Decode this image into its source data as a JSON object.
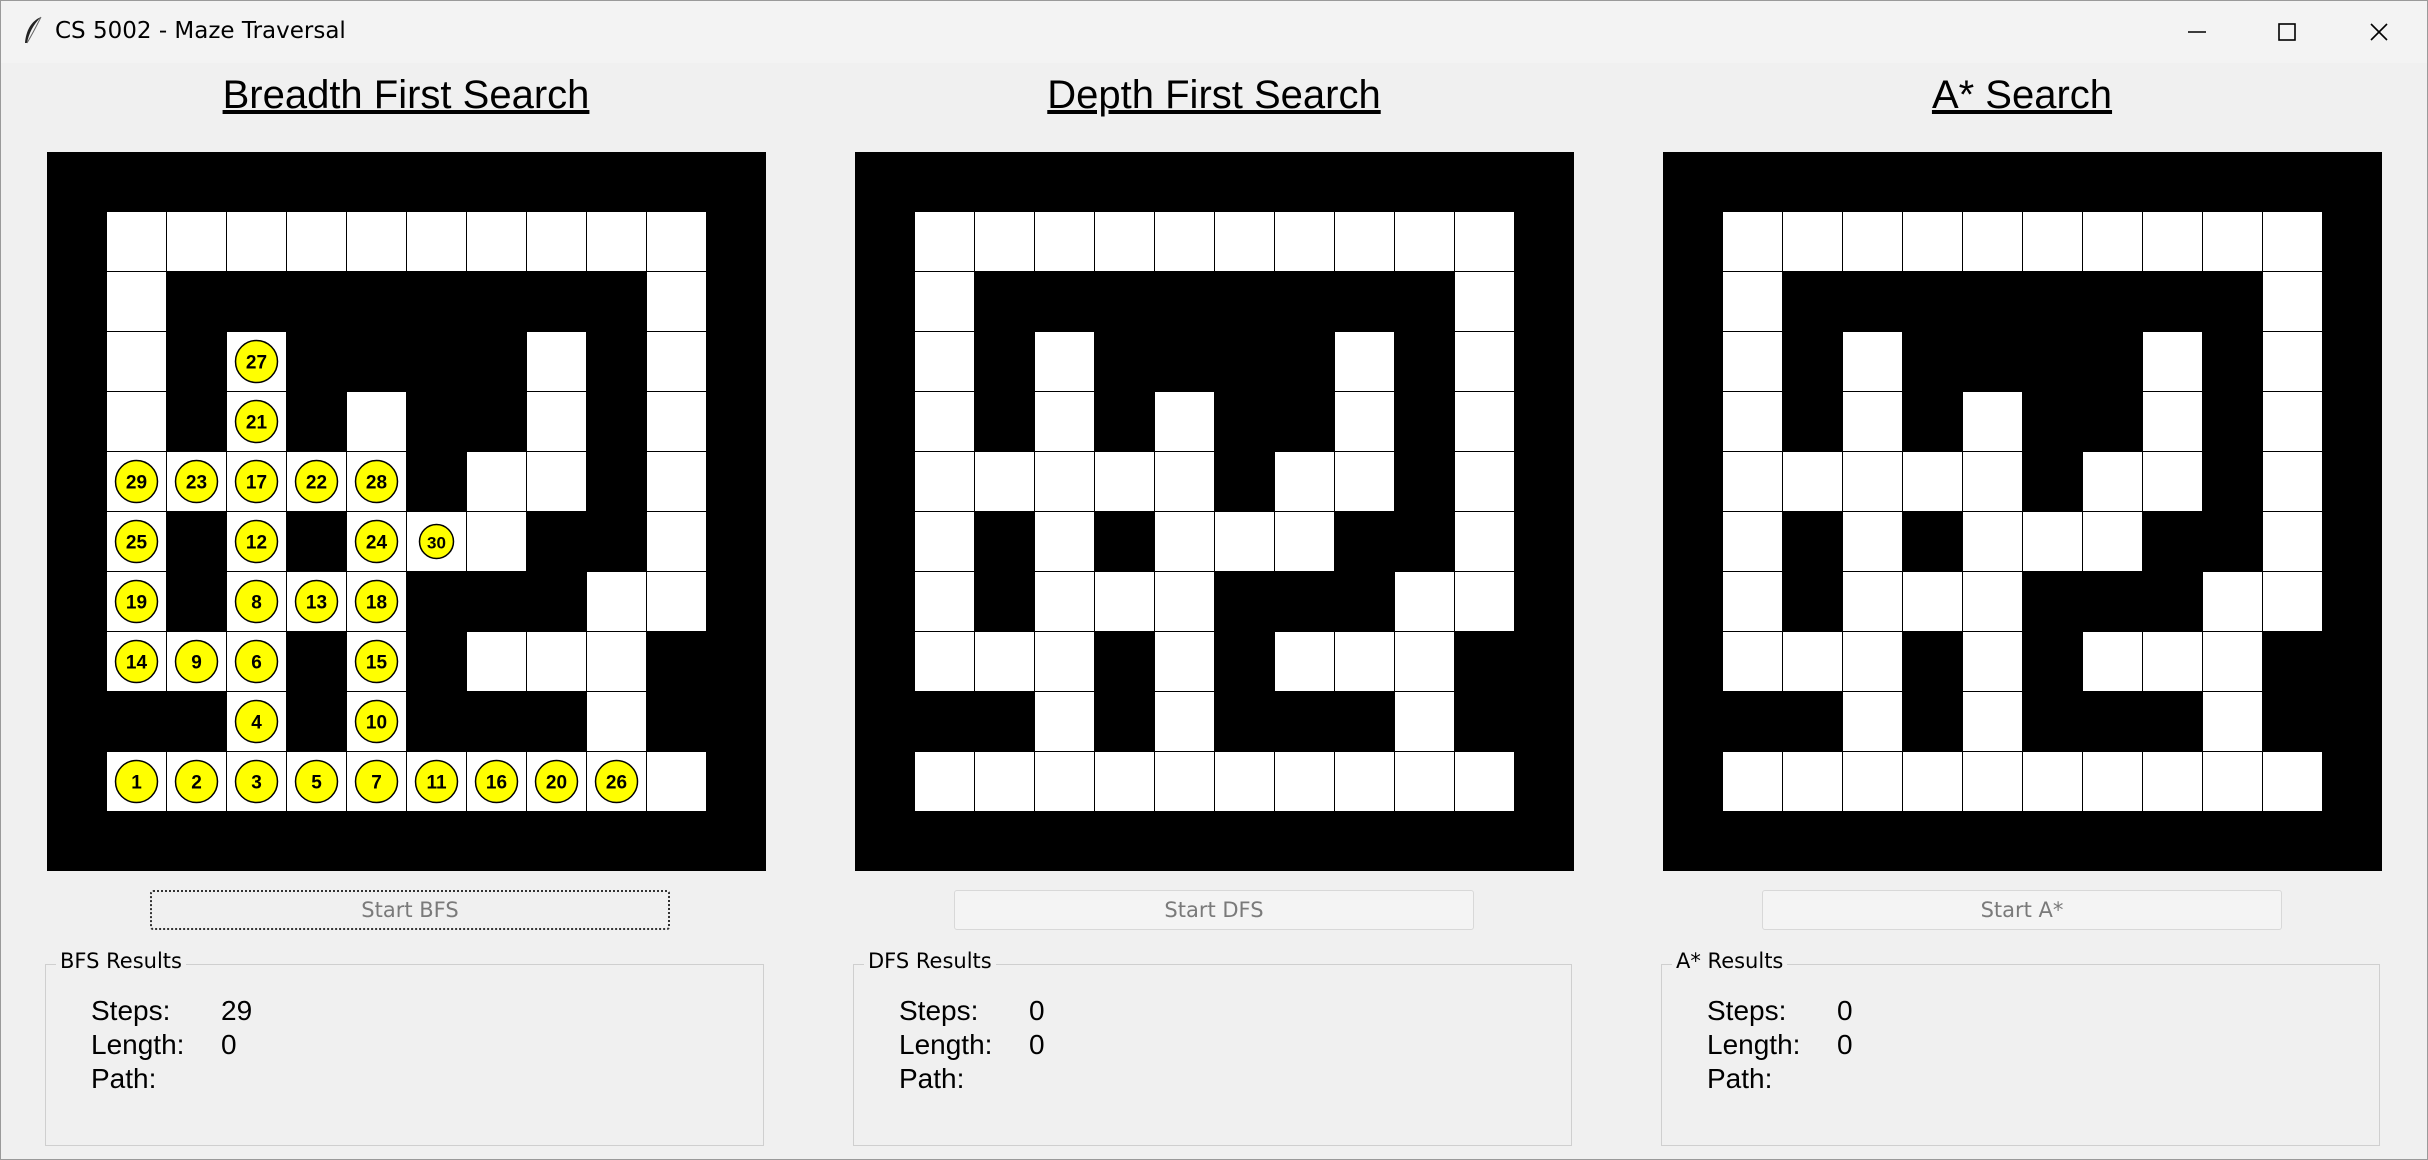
{
  "window": {
    "title": "CS 5002 - Maze Traversal"
  },
  "maze": {
    "cols": 10,
    "rows": 10,
    "walls": [
      "0000000000",
      "0111111110",
      "0101111010",
      "0101011010",
      "0000010010",
      "0101000110",
      "0100011100",
      "0001010001",
      "1101011101",
      "0000000000"
    ],
    "colors": {
      "wall": "#000000",
      "open": "#ffffff",
      "grid": "#000000",
      "visited": "#ffff00"
    }
  },
  "panels": [
    {
      "id": "bfs",
      "title": "Breadth First Search",
      "button_label": "Start BFS",
      "results_title": "BFS Results",
      "steps_label": "Steps:",
      "steps_value": "29",
      "length_label": "Length:",
      "length_value": "0",
      "path_label": "Path:",
      "path_value": "",
      "visited": [
        {
          "r": 9,
          "c": 0,
          "n": "1"
        },
        {
          "r": 9,
          "c": 1,
          "n": "2"
        },
        {
          "r": 9,
          "c": 2,
          "n": "3"
        },
        {
          "r": 8,
          "c": 2,
          "n": "4"
        },
        {
          "r": 9,
          "c": 3,
          "n": "5"
        },
        {
          "r": 7,
          "c": 2,
          "n": "6"
        },
        {
          "r": 9,
          "c": 4,
          "n": "7"
        },
        {
          "r": 6,
          "c": 2,
          "n": "8"
        },
        {
          "r": 7,
          "c": 1,
          "n": "9"
        },
        {
          "r": 8,
          "c": 4,
          "n": "10"
        },
        {
          "r": 9,
          "c": 5,
          "n": "11"
        },
        {
          "r": 5,
          "c": 2,
          "n": "12"
        },
        {
          "r": 6,
          "c": 3,
          "n": "13"
        },
        {
          "r": 7,
          "c": 0,
          "n": "14"
        },
        {
          "r": 7,
          "c": 4,
          "n": "15"
        },
        {
          "r": 9,
          "c": 6,
          "n": "16"
        },
        {
          "r": 4,
          "c": 2,
          "n": "17"
        },
        {
          "r": 6,
          "c": 4,
          "n": "18"
        },
        {
          "r": 6,
          "c": 0,
          "n": "19"
        },
        {
          "r": 9,
          "c": 7,
          "n": "20"
        },
        {
          "r": 3,
          "c": 2,
          "n": "21"
        },
        {
          "r": 4,
          "c": 3,
          "n": "22"
        },
        {
          "r": 4,
          "c": 1,
          "n": "23"
        },
        {
          "r": 5,
          "c": 4,
          "n": "24"
        },
        {
          "r": 5,
          "c": 0,
          "n": "25"
        },
        {
          "r": 9,
          "c": 8,
          "n": "26"
        },
        {
          "r": 2,
          "c": 2,
          "n": "27"
        },
        {
          "r": 4,
          "c": 4,
          "n": "28"
        },
        {
          "r": 4,
          "c": 0,
          "n": "29"
        },
        {
          "r": 5,
          "c": 5,
          "n": "30"
        }
      ]
    },
    {
      "id": "dfs",
      "title": "Depth First Search",
      "button_label": "Start DFS",
      "results_title": "DFS Results",
      "steps_label": "Steps:",
      "steps_value": "0",
      "length_label": "Length:",
      "length_value": "0",
      "path_label": "Path:",
      "path_value": "",
      "visited": []
    },
    {
      "id": "astar",
      "title": "A* Search",
      "button_label": "Start A*",
      "results_title": "A* Results",
      "steps_label": "Steps:",
      "steps_value": "0",
      "length_label": "Length:",
      "length_value": "0",
      "path_label": "Path:",
      "path_value": "",
      "visited": []
    }
  ],
  "icons": {
    "app": "feather-icon",
    "minimize": "minimize-icon",
    "maximize": "maximize-icon",
    "close": "close-icon"
  }
}
